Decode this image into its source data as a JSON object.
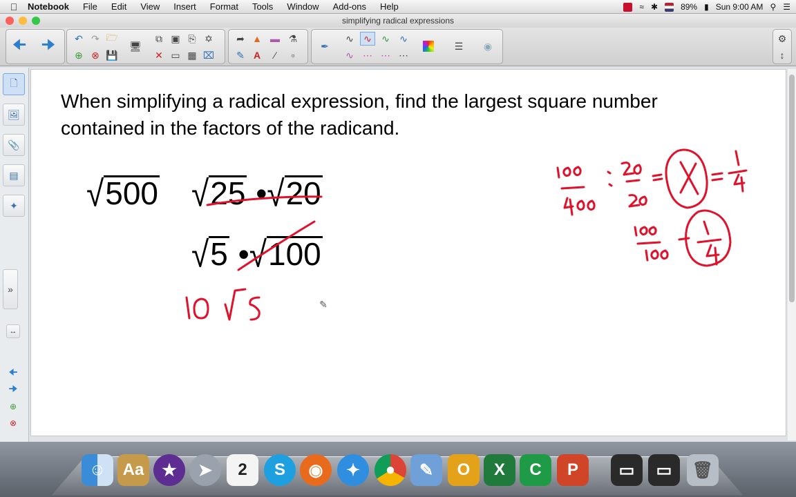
{
  "menubar": {
    "app_name": "Notebook",
    "items": [
      "File",
      "Edit",
      "View",
      "Insert",
      "Format",
      "Tools",
      "Window",
      "Add-ons",
      "Help"
    ],
    "battery": "89%",
    "clock": "Sun 9:00 AM"
  },
  "window": {
    "title": "simplifying radical expressions"
  },
  "page": {
    "instruction_line1": "When simplifying a radical expression, find the largest square number",
    "instruction_line2": "contained in the factors of the radicand.",
    "expr1_radicand": "500",
    "expr2_a": "25",
    "expr2_dot": "•",
    "expr2_b": "20",
    "expr3_a": "5",
    "expr3_dot": "•",
    "expr3_b": "100",
    "root_symbol": "√"
  },
  "ink": {
    "color": "#e0112b",
    "answer": "10 √5",
    "fraction_work": [
      "100/400",
      "20/20",
      "1/4",
      "100/100"
    ]
  },
  "icons": {
    "toolbar": [
      "back-arrow-icon",
      "forward-arrow-icon",
      "undo-icon",
      "redo-icon",
      "open-file-icon",
      "add-page-icon",
      "delete-page-icon",
      "save-icon",
      "screen-shade-icon",
      "screen-capture-icon",
      "paste-icon",
      "table-icon",
      "delete-icon",
      "select-icon",
      "fill-icon",
      "eraser-icon",
      "pen-icon",
      "font-icon",
      "line-icon",
      "shapes-icon",
      "color-palette-icon",
      "properties-icon",
      "settings-icon"
    ],
    "sidebar": [
      "page-sorter-icon",
      "gallery-icon",
      "attachments-icon",
      "properties-icon",
      "addons-icon",
      "expand-icon",
      "previous-page-icon",
      "next-page-icon",
      "add-page-icon",
      "delete-page-icon"
    ]
  }
}
